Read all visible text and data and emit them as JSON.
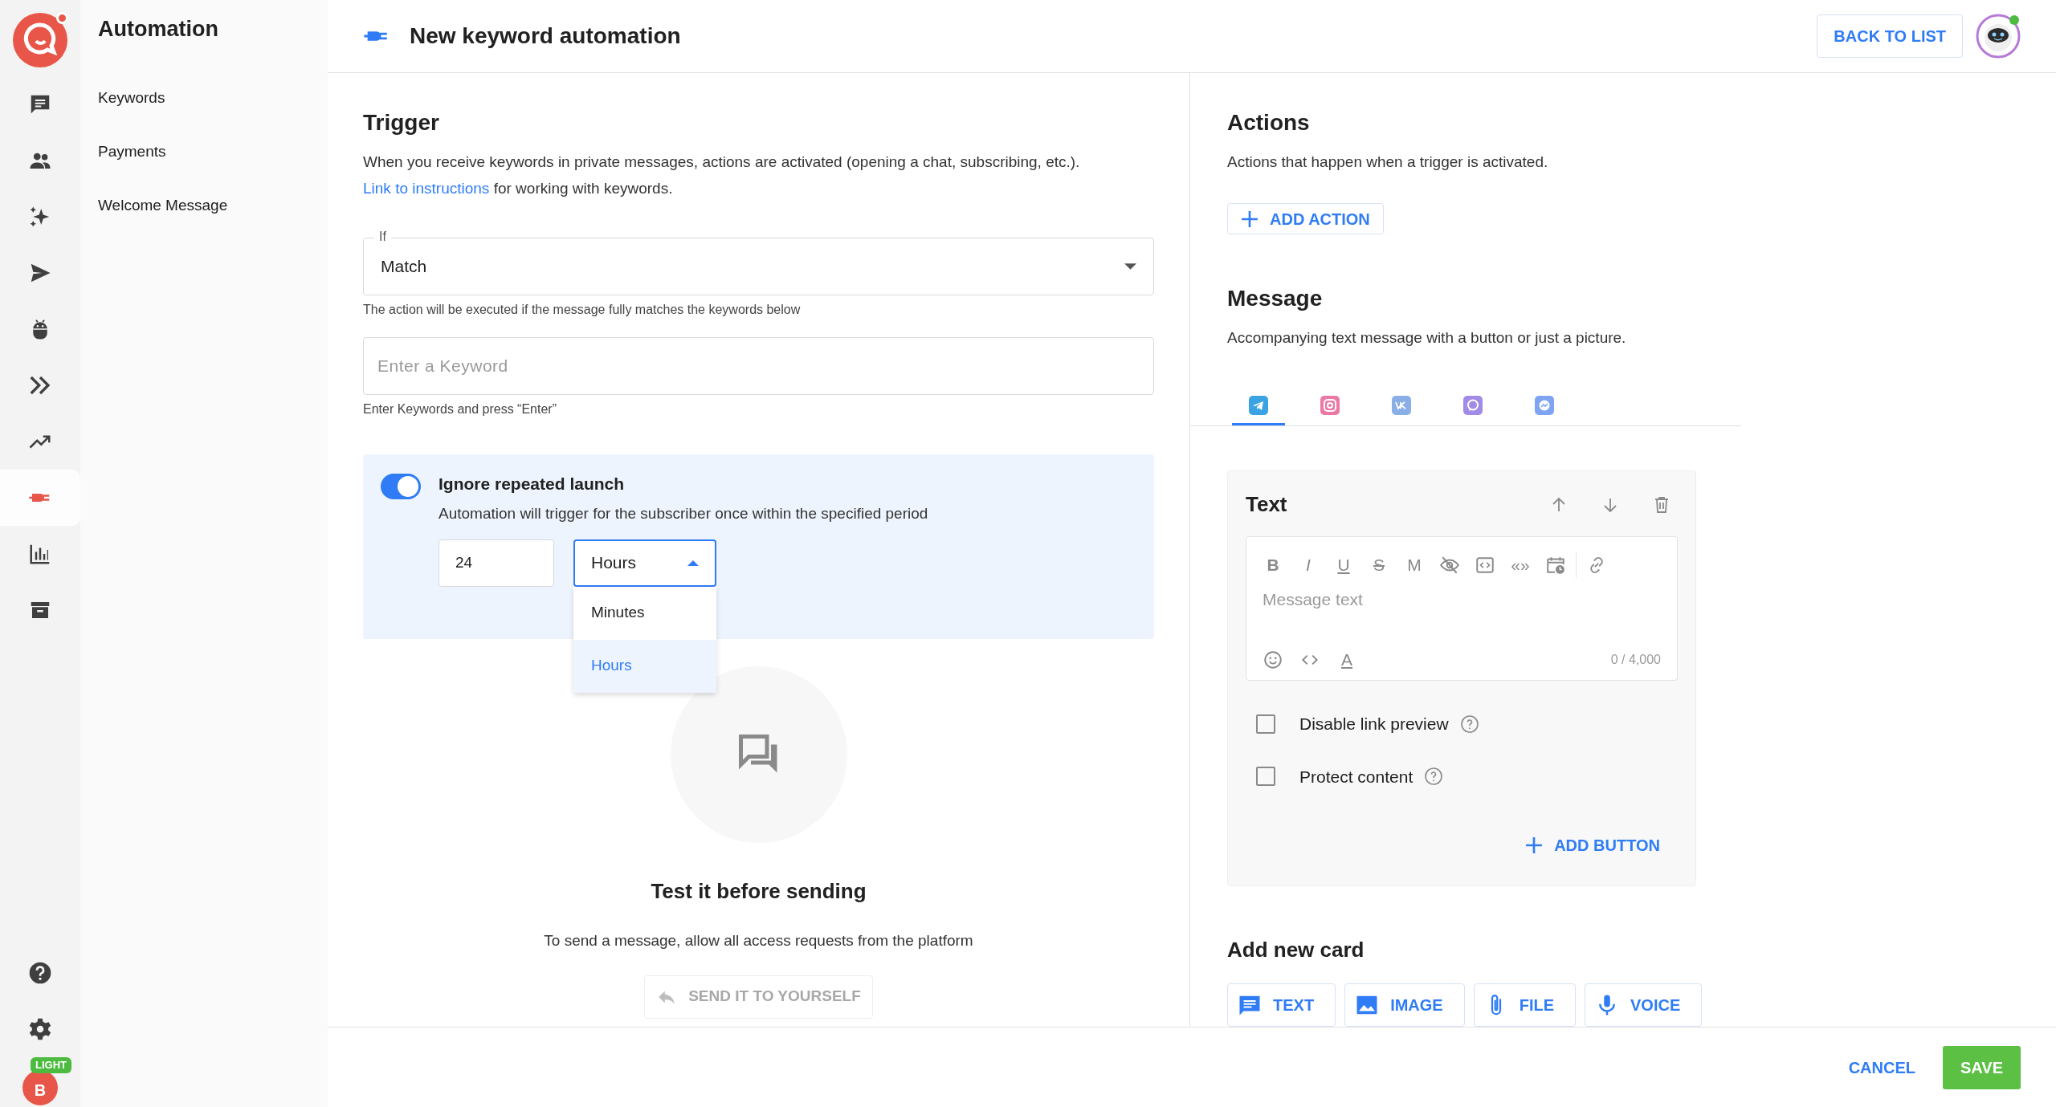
{
  "rail": {
    "logo": {
      "notification": true
    },
    "items": [
      {
        "kind": "chat",
        "selected": false
      },
      {
        "kind": "people",
        "selected": false
      },
      {
        "kind": "sparkle",
        "selected": false
      },
      {
        "kind": "send",
        "selected": false
      },
      {
        "kind": "bot",
        "selected": false
      },
      {
        "kind": "chevrons",
        "selected": false
      },
      {
        "kind": "trend",
        "selected": false
      },
      {
        "kind": "plug",
        "selected": true
      },
      {
        "kind": "chart",
        "selected": false
      },
      {
        "kind": "archive",
        "selected": false
      }
    ],
    "bottom": [
      {
        "kind": "help"
      },
      {
        "kind": "settings"
      }
    ],
    "user": {
      "initial": "B",
      "plan": "LIGHT"
    }
  },
  "sidebar": {
    "title": "Automation",
    "items": [
      {
        "label": "Keywords"
      },
      {
        "label": "Payments"
      },
      {
        "label": "Welcome Message"
      }
    ]
  },
  "header": {
    "title": "New keyword automation",
    "back_button": "BACK TO LIST",
    "online": true
  },
  "trigger": {
    "heading": "Trigger",
    "text_before": "When you receive keywords in private messages, actions are activated (opening a chat, subscribing, etc.). ",
    "link": "Link to instructions",
    "text_after": " for working with keywords.",
    "condition": {
      "label": "If",
      "value": "Match",
      "helper": "The action will be executed if the message fully matches the keywords below"
    },
    "keyword": {
      "placeholder": "Enter a Keyword",
      "helper": "Enter Keywords and press “Enter”"
    },
    "repeat": {
      "on": true,
      "title": "Ignore repeated launch",
      "description": "Automation will trigger for the subscriber once within the specified period",
      "amount": "24",
      "unit": "Hours",
      "expanded": true,
      "options": [
        {
          "label": "Minutes",
          "selected": false
        },
        {
          "label": "Hours",
          "selected": true
        }
      ]
    }
  },
  "test": {
    "heading": "Test it before sending",
    "description": "To send a message, allow all access requests from the platform",
    "button": "SEND IT TO YOURSELF",
    "disabled": true
  },
  "actions": {
    "heading": "Actions",
    "description": "Actions that happen when a trigger is activated.",
    "button": "ADD ACTION"
  },
  "message": {
    "heading": "Message",
    "description": "Accompanying text message with a button or just a picture.",
    "channels": [
      {
        "kind": "telegram",
        "selected": true
      },
      {
        "kind": "instagram",
        "selected": false
      },
      {
        "kind": "vk",
        "selected": false
      },
      {
        "kind": "viber",
        "selected": false
      },
      {
        "kind": "messenger",
        "selected": false
      }
    ],
    "card": {
      "title": "Text",
      "tools": [
        {
          "kind": "bold",
          "text": "B"
        },
        {
          "kind": "italic",
          "text": "I"
        },
        {
          "kind": "underline",
          "text": "U"
        },
        {
          "kind": "strike",
          "text": "S"
        },
        {
          "kind": "letter",
          "text": "M"
        },
        {
          "kind": "hidden"
        },
        {
          "kind": "code"
        },
        {
          "kind": "quote",
          "text": "«»"
        },
        {
          "kind": "schedule"
        },
        {
          "kind": "link"
        }
      ],
      "placeholder": "Message text",
      "bottom_tools": [
        {
          "kind": "emoji"
        },
        {
          "kind": "brackets"
        },
        {
          "kind": "color",
          "text": "A"
        }
      ],
      "counter": "0 / 4,000",
      "options": [
        {
          "label": "Disable link preview",
          "checked": false
        },
        {
          "label": "Protect content",
          "checked": false
        }
      ],
      "add_button": "ADD BUTTON"
    }
  },
  "add_card": {
    "heading": "Add new card",
    "buttons": [
      {
        "kind": "text",
        "label": "TEXT"
      },
      {
        "kind": "image",
        "label": "IMAGE"
      },
      {
        "kind": "file",
        "label": "FILE"
      },
      {
        "kind": "voice",
        "label": "VOICE"
      }
    ]
  },
  "footer": {
    "cancel": "CANCEL",
    "save": "SAVE"
  }
}
